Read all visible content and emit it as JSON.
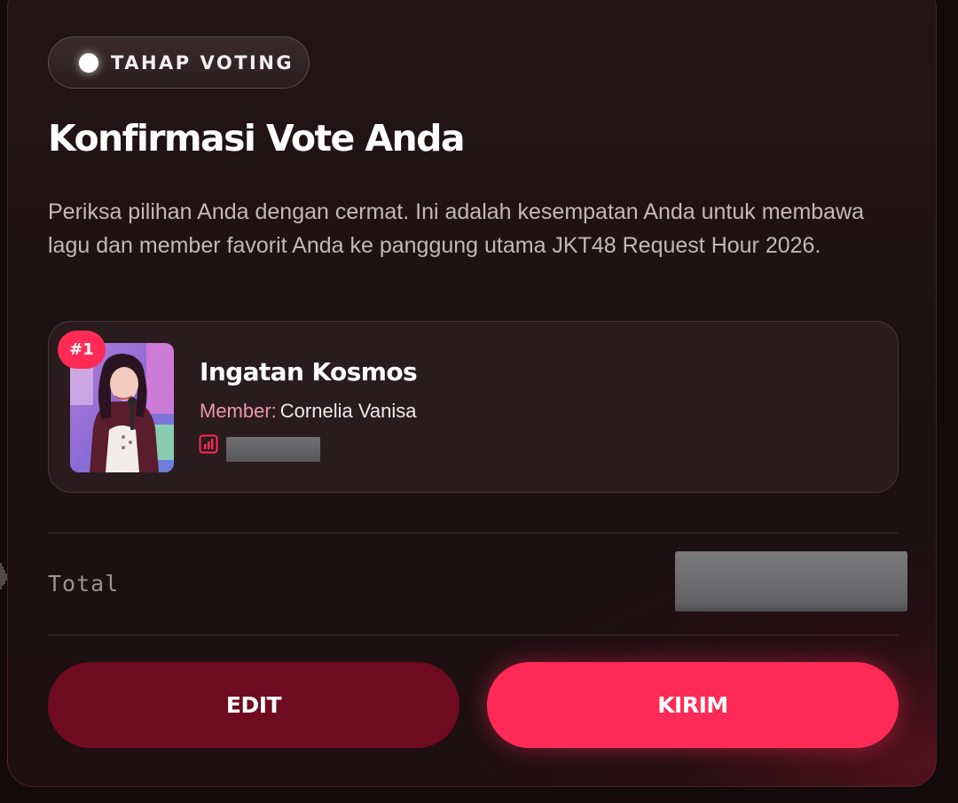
{
  "badge": {
    "label": "TAHAP VOTING"
  },
  "title": "Konfirmasi Vote Anda",
  "description": "Periksa pilihan Anda dengan cermat. Ini adalah kesempatan Anda untuk membawa lagu dan member favorit Anda ke panggung utama JKT48 Request Hour 2026.",
  "selection": {
    "rank": "#1",
    "song": "Ingatan Kosmos",
    "member_label": "Member:",
    "member_name": "Cornelia Vanisa",
    "stat_icon": "bar-chart-icon"
  },
  "summary": {
    "total_label": "Total"
  },
  "actions": {
    "edit_label": "EDIT",
    "send_label": "KIRIM"
  },
  "colors": {
    "accent": "#ff2a55",
    "edit_button": "#6e0b1f",
    "member_label": "#e79aac",
    "background": "#130a0c"
  }
}
